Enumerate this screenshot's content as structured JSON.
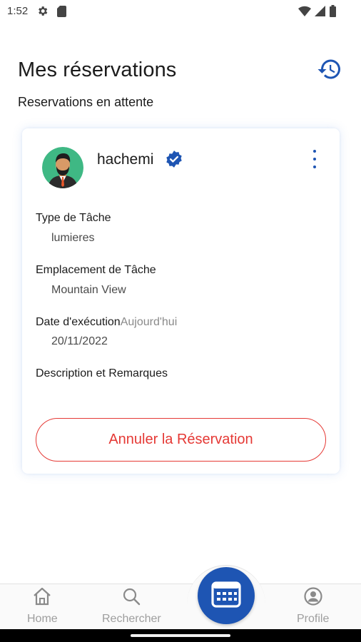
{
  "status_bar": {
    "time": "1:52",
    "icons": [
      "gear-icon",
      "sd-card-icon",
      "wifi-icon",
      "signal-icon",
      "battery-icon"
    ]
  },
  "header": {
    "title": "Mes réservations",
    "history_icon": "history-icon"
  },
  "section": {
    "title": "Reservations en attente"
  },
  "reservation": {
    "user_name": "hachemi",
    "verified_icon": "verified-badge-icon",
    "menu_icon": "more-vert-icon",
    "fields": {
      "task_type_label": "Type de Tâche",
      "task_type_value": "lumieres",
      "location_label": "Emplacement de Tâche",
      "location_value": "Mountain View",
      "date_label": "Date d'exécution",
      "date_extra": "Aujourd'hui",
      "date_value": "20/11/2022",
      "description_label": "Description et Remarques"
    },
    "cancel_label": "Annuler la Réservation"
  },
  "bottom_nav": {
    "home_label": "Home",
    "search_label": "Rechercher",
    "profile_label": "Profile",
    "center_icon": "calendar-icon"
  },
  "colors": {
    "accent": "#1e55b3",
    "cancel": "#e53935",
    "nav_inactive": "#9e9e9e"
  }
}
